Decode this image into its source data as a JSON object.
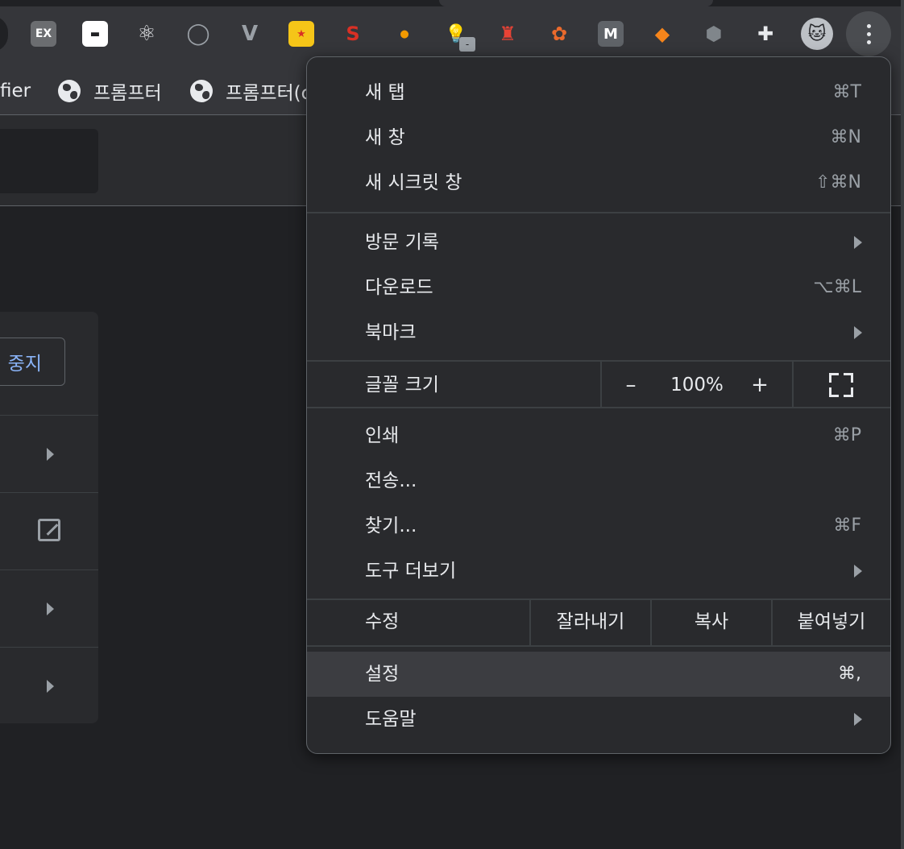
{
  "toolbar": {
    "extensions": [
      {
        "name": "ex-extension-icon",
        "glyph": "EX",
        "bg": "#6b6d70",
        "fg": "#ffffff"
      },
      {
        "name": "mask-extension-icon",
        "glyph": "▬",
        "bg": "#ffffff",
        "fg": "#202124"
      },
      {
        "name": "react-devtools-icon",
        "glyph": "⚛",
        "bg": "transparent",
        "fg": "#e8eaed"
      },
      {
        "name": "ring-extension-icon",
        "glyph": "◯",
        "bg": "transparent",
        "fg": "#9aa0a6"
      },
      {
        "name": "vue-devtools-icon",
        "glyph": "V",
        "bg": "transparent",
        "fg": "#9aa0a6"
      },
      {
        "name": "star-extension-icon",
        "glyph": "★",
        "bg": "#f5c518",
        "fg": "#d93025"
      },
      {
        "name": "seo-extension-icon",
        "glyph": "S",
        "bg": "transparent",
        "fg": "#d93025"
      },
      {
        "name": "moon-extension-icon",
        "glyph": "●",
        "bg": "transparent",
        "fg": "#f29900"
      },
      {
        "name": "lightbulb-extension-icon",
        "glyph": "💡",
        "bg": "transparent",
        "fg": "#8ab4f8"
      },
      {
        "name": "lighthouse-icon",
        "glyph": "♜",
        "bg": "transparent",
        "fg": "#ea4335"
      },
      {
        "name": "maple-leaf-icon",
        "glyph": "✿",
        "bg": "transparent",
        "fg": "#ea6a2c"
      },
      {
        "name": "m-extension-icon",
        "glyph": "M",
        "bg": "#5f6368",
        "fg": "#ffffff"
      },
      {
        "name": "metamask-fox-icon",
        "glyph": "◆",
        "bg": "transparent",
        "fg": "#f6851b"
      },
      {
        "name": "kite-extension-icon",
        "glyph": "⬢",
        "bg": "transparent",
        "fg": "#80868b"
      },
      {
        "name": "puzzle-extensions-icon",
        "glyph": "✚",
        "bg": "transparent",
        "fg": "#e8eaed"
      },
      {
        "name": "profile-avatar",
        "glyph": "🐱",
        "bg": "#bdc1c6",
        "fg": "#202124"
      }
    ],
    "extension_badge": "-"
  },
  "bookmarks": [
    {
      "label": "fier"
    },
    {
      "label": "프롬프터"
    },
    {
      "label": "프롬프터(c"
    }
  ],
  "page": {
    "stop_button": "중지"
  },
  "menu": {
    "new_tab": {
      "label": "새 탭",
      "shortcut": "⌘T"
    },
    "new_window": {
      "label": "새 창",
      "shortcut": "⌘N"
    },
    "new_incognito": {
      "label": "새 시크릿 창",
      "shortcut": "⇧⌘N"
    },
    "history": {
      "label": "방문 기록"
    },
    "downloads": {
      "label": "다운로드",
      "shortcut": "⌥⌘L"
    },
    "bookmarks": {
      "label": "북마크"
    },
    "zoom": {
      "label": "글꼴 크기",
      "minus": "–",
      "value": "100%",
      "plus": "+"
    },
    "print": {
      "label": "인쇄",
      "shortcut": "⌘P"
    },
    "cast": {
      "label": "전송..."
    },
    "find": {
      "label": "찾기...",
      "shortcut": "⌘F"
    },
    "more_tools": {
      "label": "도구 더보기"
    },
    "edit": {
      "label": "수정",
      "cut": "잘라내기",
      "copy": "복사",
      "paste": "붙여넣기"
    },
    "settings": {
      "label": "설정",
      "shortcut": "⌘,"
    },
    "help": {
      "label": "도움말"
    }
  }
}
